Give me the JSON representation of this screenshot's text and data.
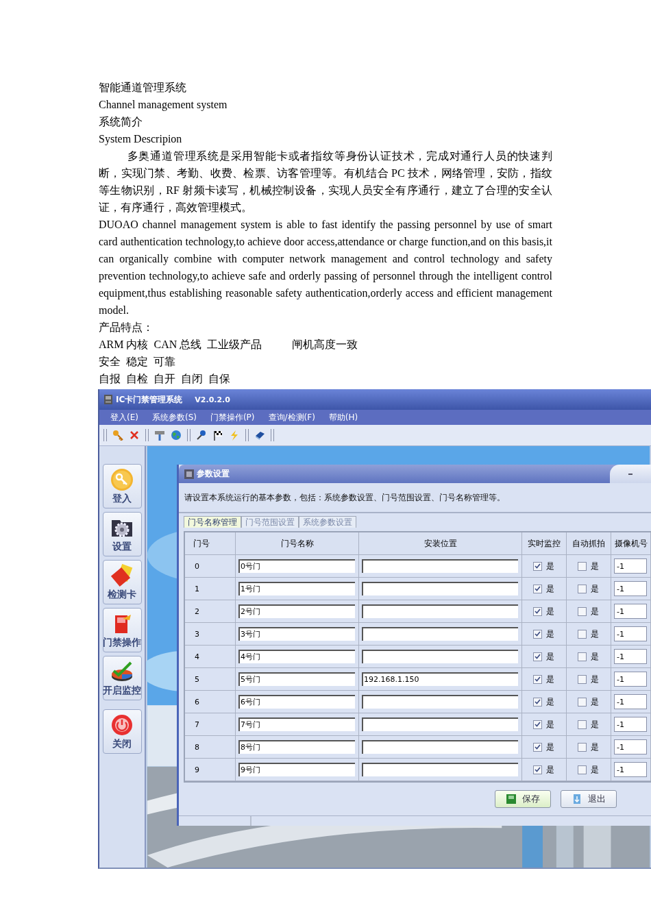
{
  "document": {
    "title": "智能通道管理系统",
    "title_en": "Channel management system",
    "section": "系统简介",
    "section_en": "System Descripion",
    "intro": "多奥通道管理系统是采用智能卡或者指纹等身份认证技术，完成对通行人员的快速判断，实现门禁、考勤、收费、检票、访客管理等。有机结合 PC 技术，网络管理，安防，指纹等生物识别，RF 射频卡读写，机械控制设备，实现人员安全有序通行，建立了合理的安全认证，有序通行，高效管理模式。",
    "intro_en": "DUOAO channel management system is able to fast identify the passing personnel by use of smart card authentication technology,to achieve door access,attendance or charge function,and on this basis,it can organically combine with computer network management and control technology and safety prevention technology,to achieve safe and orderly passing of personnel through the intelligent control equipment,thus establishing reasonable safety authentication,orderly access and efficient management model.",
    "features_heading": "产品特点：",
    "features": [
      "ARM 内核  CAN 总线  工业级产品           闸机高度一致",
      "安全  稳定  可靠",
      "自报  自检  自开  自闭  自保"
    ]
  },
  "app": {
    "window": {
      "title": "IC卡门禁管理系统",
      "version": "V2.0.2.0"
    },
    "menu": [
      "登入(E)",
      "系统参数(S)",
      "门禁操作(P)",
      "查询/检测(F)",
      "帮助(H)"
    ],
    "sidebar": [
      "登入",
      "设置",
      "检测卡",
      "门禁操作",
      "开启监控",
      "关闭"
    ],
    "dialog": {
      "title": "参数设置",
      "description": "请设置本系统运行的基本参数，包括：系统参数设置、门号范围设置、门号名称管理等。",
      "tabs": [
        {
          "label": "门号名称管理",
          "selected": true
        },
        {
          "label": "门号范围设置",
          "selected": false
        },
        {
          "label": "系统参数设置",
          "selected": false
        }
      ],
      "table": {
        "columns": [
          "门号",
          "门号名称",
          "安装位置",
          "实时监控",
          "自动抓拍",
          "摄像机号"
        ],
        "rows": [
          {
            "number": "0",
            "name": "0号门",
            "location": "",
            "realtime_monitor": true,
            "monitor_label": "是",
            "auto_capture": false,
            "capture_label": "是",
            "camera": "-1"
          },
          {
            "number": "1",
            "name": "1号门",
            "location": "",
            "realtime_monitor": true,
            "monitor_label": "是",
            "auto_capture": false,
            "capture_label": "是",
            "camera": "-1"
          },
          {
            "number": "2",
            "name": "2号门",
            "location": "",
            "realtime_monitor": true,
            "monitor_label": "是",
            "auto_capture": false,
            "capture_label": "是",
            "camera": "-1"
          },
          {
            "number": "3",
            "name": "3号门",
            "location": "",
            "realtime_monitor": true,
            "monitor_label": "是",
            "auto_capture": false,
            "capture_label": "是",
            "camera": "-1"
          },
          {
            "number": "4",
            "name": "4号门",
            "location": "",
            "realtime_monitor": true,
            "monitor_label": "是",
            "auto_capture": false,
            "capture_label": "是",
            "camera": "-1"
          },
          {
            "number": "5",
            "name": "5号门",
            "location": "192.168.1.150",
            "realtime_monitor": true,
            "monitor_label": "是",
            "auto_capture": false,
            "capture_label": "是",
            "camera": "-1"
          },
          {
            "number": "6",
            "name": "6号门",
            "location": "",
            "realtime_monitor": true,
            "monitor_label": "是",
            "auto_capture": false,
            "capture_label": "是",
            "camera": "-1"
          },
          {
            "number": "7",
            "name": "7号门",
            "location": "",
            "realtime_monitor": true,
            "monitor_label": "是",
            "auto_capture": false,
            "capture_label": "是",
            "camera": "-1"
          },
          {
            "number": "8",
            "name": "8号门",
            "location": "",
            "realtime_monitor": true,
            "monitor_label": "是",
            "auto_capture": false,
            "capture_label": "是",
            "camera": "-1"
          },
          {
            "number": "9",
            "name": "9号门",
            "location": "",
            "realtime_monitor": true,
            "monitor_label": "是",
            "auto_capture": false,
            "capture_label": "是",
            "camera": "-1"
          }
        ]
      },
      "buttons": [
        "保存",
        "退出"
      ]
    }
  }
}
